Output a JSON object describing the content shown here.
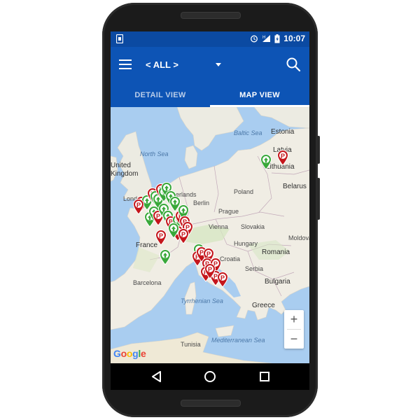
{
  "status_bar": {
    "time": "10:07"
  },
  "app_bar": {
    "filter_value": "< ALL >",
    "icons": [
      "menu-icon",
      "dropdown-caret-icon",
      "search-icon"
    ]
  },
  "tabs": [
    {
      "label": "DETAIL VIEW",
      "active": false
    },
    {
      "label": "MAP VIEW",
      "active": true
    }
  ],
  "map": {
    "labels": {
      "estonia": "Estonia",
      "latvia": "Latvia",
      "lithuania": "Lithuania",
      "belarus": "Belarus",
      "united_kingdom_1": "United",
      "united_kingdom_2": "Kingdom",
      "north_sea": "North Sea",
      "baltic_sea": "Baltic Sea",
      "netherlands": "Netherlands",
      "london": "London",
      "berlin": "Berlin",
      "poland": "Poland",
      "prague": "Prague",
      "slovakia": "Slovakia",
      "vienna": "Vienna",
      "france": "France",
      "hungary": "Hungary",
      "romania": "Romania",
      "moldova": "Moldova",
      "croatia": "Croatia",
      "serbia": "Serbia",
      "bulgaria": "Bulgaria",
      "barcelona": "Barcelona",
      "tyrrhenian": "Tyrrhenian Sea",
      "greece": "Greece",
      "tunisia": "Tunisia",
      "mediterranean": "Mediterranean Sea"
    },
    "zoom_in": "+",
    "zoom_out": "−",
    "google": [
      "G",
      "o",
      "o",
      "g",
      "l",
      "e"
    ],
    "colors": {
      "parking_pin": "#c4161c",
      "charging_pin": "#39a83a",
      "land": "#f0ede4",
      "water": "#a9cdf0",
      "app_bar": "#0d54b5"
    }
  },
  "nav_bar": {
    "icons": [
      "back-icon",
      "home-icon",
      "recents-icon"
    ]
  }
}
